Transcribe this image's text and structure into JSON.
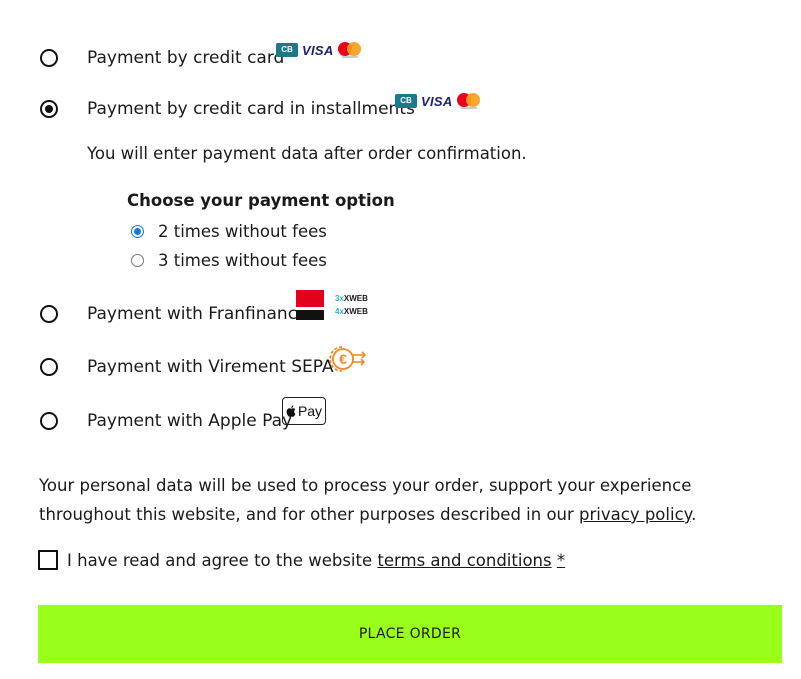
{
  "payment_methods": [
    {
      "label": "Payment by credit card",
      "selected": false,
      "logos": [
        "cb-icon",
        "visa-icon",
        "mastercard-icon"
      ]
    },
    {
      "label": "Payment by credit card in installments",
      "selected": true,
      "logos": [
        "cb-icon",
        "visa-icon",
        "mastercard-icon"
      ]
    },
    {
      "label": "Payment with Franfinance",
      "selected": false,
      "logos": [
        "franfinance-logo",
        "3xweb-4xweb-badge"
      ]
    },
    {
      "label": "Payment with Virement SEPA",
      "selected": false,
      "logos": [
        "euro-transfer-icon"
      ]
    },
    {
      "label": "Payment with Apple Pay",
      "selected": false,
      "logos": [
        "apple-pay-icon"
      ]
    }
  ],
  "logos": {
    "cb": "CB",
    "visa": "VISA",
    "xweb_3": "3",
    "xweb_4": "4",
    "xweb_suffix": "XWEB",
    "apple_pay": "Pay"
  },
  "installments": {
    "info_text": "You will enter payment data after order confirmation.",
    "title": "Choose your payment option",
    "options": [
      {
        "label": "2 times without fees",
        "selected": true
      },
      {
        "label": "3 times without fees",
        "selected": false
      }
    ]
  },
  "privacy": {
    "text_before": "Your personal data will be used to process your order, support your experience throughout this website, and for other purposes described in our ",
    "link_text": "privacy policy",
    "text_after": "."
  },
  "terms": {
    "checked": false,
    "text_before": "I have read and agree to the website ",
    "link_text": "terms and conditions",
    "required_marker": "*"
  },
  "place_order_label": "PLACE ORDER",
  "colors": {
    "place_order_bg": "#99ff1a",
    "radio_accent": "#1473e6",
    "visa_blue": "#1a1f71",
    "cb_teal": "#1a7a8c",
    "franfinance_red": "#e2001a",
    "xweb_teal": "#2bb3c0",
    "sepa_orange": "#f08a24"
  }
}
